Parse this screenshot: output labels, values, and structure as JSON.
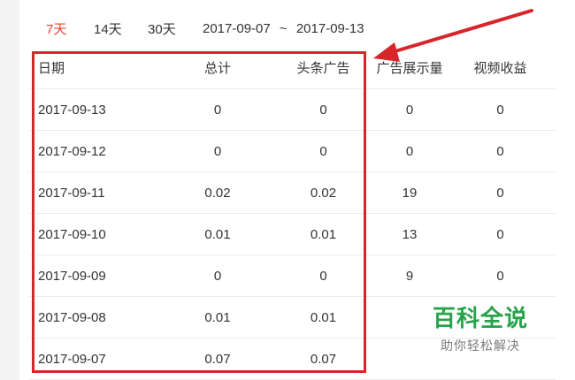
{
  "range_tabs": [
    {
      "label": "7天",
      "active": true
    },
    {
      "label": "14天",
      "active": false
    },
    {
      "label": "30天",
      "active": false
    }
  ],
  "date_range": {
    "start": "2017-09-07",
    "separator": "~",
    "end": "2017-09-13"
  },
  "table": {
    "headers": [
      "日期",
      "总计",
      "头条广告",
      "广告展示量",
      "视频收益"
    ],
    "rows": [
      [
        "2017-09-13",
        "0",
        "0",
        "0",
        "0"
      ],
      [
        "2017-09-12",
        "0",
        "0",
        "0",
        "0"
      ],
      [
        "2017-09-11",
        "0.02",
        "0.02",
        "19",
        "0"
      ],
      [
        "2017-09-10",
        "0.01",
        "0.01",
        "13",
        "0"
      ],
      [
        "2017-09-09",
        "0",
        "0",
        "9",
        "0"
      ],
      [
        "2017-09-08",
        "0.01",
        "0.01",
        "",
        ""
      ],
      [
        "2017-09-07",
        "0.07",
        "0.07",
        "",
        ""
      ]
    ]
  },
  "annotation": {
    "color": "#d8252a"
  },
  "watermark": {
    "title": "百科全说",
    "subtitle": "助你轻松解决",
    "color": "#27a34a"
  }
}
